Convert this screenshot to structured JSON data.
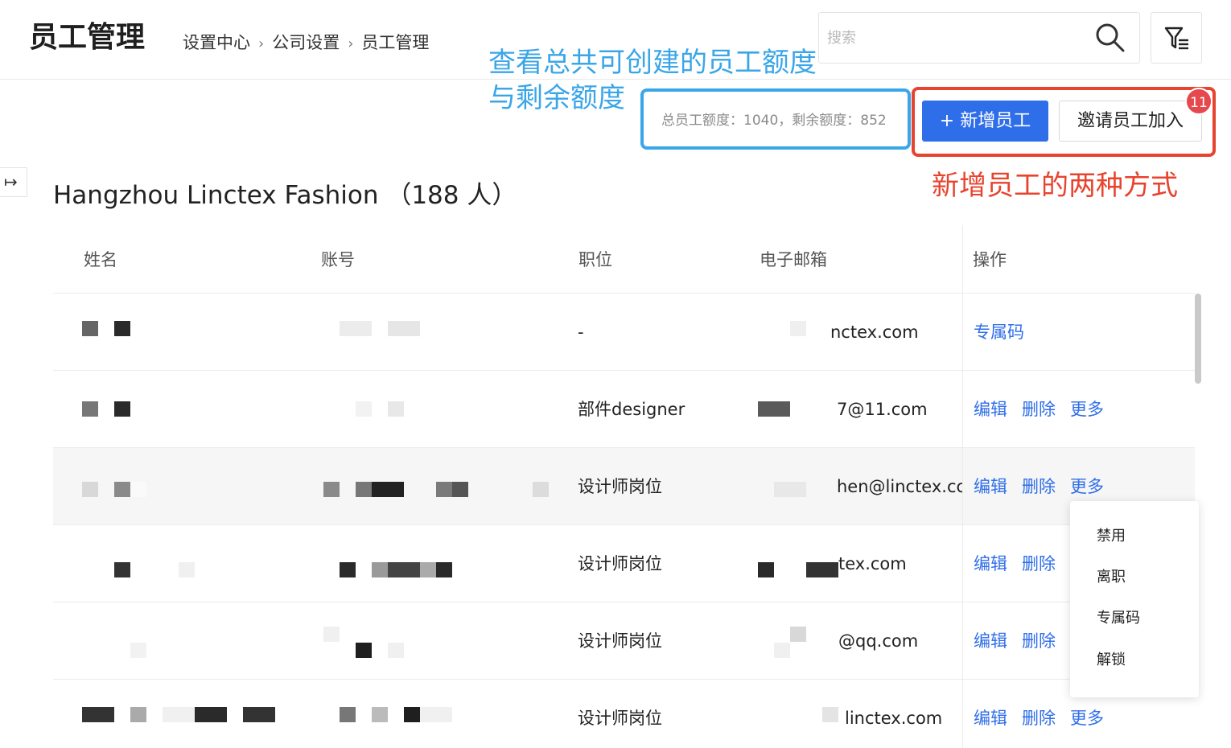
{
  "header": {
    "title": "员工管理",
    "breadcrumb": [
      "设置中心",
      "公司设置",
      "员工管理"
    ],
    "breadcrumb_separator": "›",
    "search_placeholder": "搜索"
  },
  "annotations": {
    "quota_note_line1": "查看总共可创建的员工额度",
    "quota_note_line2": "与剩余额度",
    "actions_note": "新增员工的两种方式",
    "blue": "#3aa6e8",
    "red": "#e8432e"
  },
  "quota": {
    "text": "总员工额度：1040，剩余额度：852"
  },
  "actions": {
    "add_label": "+ 新增员工",
    "invite_label": "邀请员工加入",
    "invite_badge": "11",
    "accent": "#2f6ee9"
  },
  "company": {
    "title": "Hangzhou Linctex Fashion （188 人）"
  },
  "table": {
    "columns": [
      "姓名",
      "账号",
      "职位",
      "电子邮箱",
      "操作"
    ],
    "rows": [
      {
        "position": "-",
        "email": "nctex.com",
        "actions": [
          "专属码"
        ]
      },
      {
        "position": "部件designer",
        "email": "7@11.com",
        "actions": [
          "编辑",
          "删除",
          "更多"
        ]
      },
      {
        "position": "设计师岗位",
        "email": "hen@linctex.cc",
        "actions": [
          "编辑",
          "删除",
          "更多"
        ]
      },
      {
        "position": "设计师岗位",
        "email": "tex.com",
        "actions": [
          "编辑",
          "删除"
        ]
      },
      {
        "position": "设计师岗位",
        "email": "@qq.com",
        "actions": [
          "编辑",
          "删除"
        ]
      },
      {
        "position": "设计师岗位",
        "email": "linctex.com",
        "actions": [
          "编辑",
          "删除",
          "更多"
        ]
      }
    ]
  },
  "more_menu": {
    "items": [
      "禁用",
      "离职",
      "专属码",
      "解锁"
    ]
  },
  "icons": {
    "search": "search-icon",
    "filter": "filter-icon",
    "collapse": "sidebar-expand-icon"
  }
}
